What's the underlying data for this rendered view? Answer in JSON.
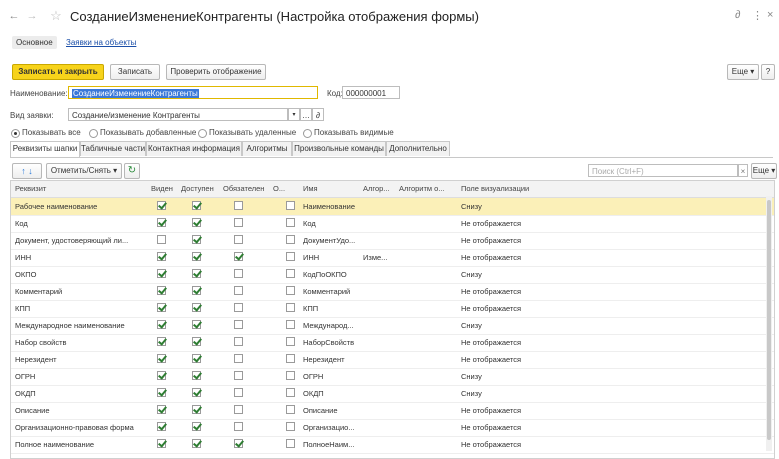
{
  "window": {
    "title": "СозданиеИзменениеКонтрагенты (Настройка отображения формы)"
  },
  "top_tabs": [
    {
      "label": "Основное"
    },
    {
      "label": "Заявки на объекты"
    }
  ],
  "toolbar": {
    "save_close": "Записать и закрыть",
    "save": "Записать",
    "check": "Проверить отображение",
    "more": "Еще",
    "help": "?"
  },
  "form": {
    "name_label": "Наименование:",
    "name_value": "СозданиеИзменениеКонтрагенты",
    "code_label": "Код:",
    "code_value": "000000001",
    "type_label": "Вид заявки:",
    "type_value": "Создание/изменение Контрагенты"
  },
  "radios": [
    {
      "label": "Показывать все",
      "checked": true
    },
    {
      "label": "Показывать добавленные",
      "checked": false
    },
    {
      "label": "Показывать удаленные",
      "checked": false
    },
    {
      "label": "Показывать видимые",
      "checked": false
    }
  ],
  "sub_tabs": [
    "Реквизиты шапки",
    "Табличные части",
    "Контактная информация",
    "Алгоритмы",
    "Произвольные команды",
    "Дополнительно"
  ],
  "table_toolbar": {
    "mark": "Отметить/Снять",
    "search_placeholder": "Поиск (Ctrl+F)",
    "more": "Еще"
  },
  "columns": [
    "Реквизит",
    "Виден",
    "Доступен",
    "Обязателен",
    "О...",
    "Имя",
    "Алгор...",
    "Алгоритм о...",
    "Поле визуализации"
  ],
  "rows": [
    {
      "rekvizit": "Рабочее наименование",
      "viden": true,
      "dostupen": true,
      "obyaz": false,
      "o": false,
      "imya": "Наименование",
      "algor": "",
      "algoritm": "",
      "pole": "Снизу",
      "selected": true
    },
    {
      "rekvizit": "Код",
      "viden": true,
      "dostupen": true,
      "obyaz": false,
      "o": false,
      "imya": "Код",
      "algor": "",
      "algoritm": "",
      "pole": "Не отображается",
      "selected": false
    },
    {
      "rekvizit": "Документ, удостоверяющий ли...",
      "viden": false,
      "dostupen": true,
      "obyaz": false,
      "o": false,
      "imya": "ДокументУдо...",
      "algor": "",
      "algoritm": "",
      "pole": "Не отображается",
      "selected": false
    },
    {
      "rekvizit": "ИНН",
      "viden": true,
      "dostupen": true,
      "obyaz": true,
      "o": false,
      "imya": "ИНН",
      "algor": "Изме...",
      "algoritm": "",
      "pole": "Не отображается",
      "selected": false
    },
    {
      "rekvizit": "ОКПО",
      "viden": true,
      "dostupen": true,
      "obyaz": false,
      "o": false,
      "imya": "КодПоОКПО",
      "algor": "",
      "algoritm": "",
      "pole": "Снизу",
      "selected": false
    },
    {
      "rekvizit": "Комментарий",
      "viden": true,
      "dostupen": true,
      "obyaz": false,
      "o": false,
      "imya": "Комментарий",
      "algor": "",
      "algoritm": "",
      "pole": "Не отображается",
      "selected": false
    },
    {
      "rekvizit": "КПП",
      "viden": true,
      "dostupen": true,
      "obyaz": false,
      "o": false,
      "imya": "КПП",
      "algor": "",
      "algoritm": "",
      "pole": "Не отображается",
      "selected": false
    },
    {
      "rekvizit": "Международное наименование",
      "viden": true,
      "dostupen": true,
      "obyaz": false,
      "o": false,
      "imya": "Международ...",
      "algor": "",
      "algoritm": "",
      "pole": "Снизу",
      "selected": false
    },
    {
      "rekvizit": "Набор свойств",
      "viden": true,
      "dostupen": true,
      "obyaz": false,
      "o": false,
      "imya": "НаборСвойств",
      "algor": "",
      "algoritm": "",
      "pole": "Не отображается",
      "selected": false
    },
    {
      "rekvizit": "Нерезидент",
      "viden": true,
      "dostupen": true,
      "obyaz": false,
      "o": false,
      "imya": "Нерезидент",
      "algor": "",
      "algoritm": "",
      "pole": "Не отображается",
      "selected": false
    },
    {
      "rekvizit": "ОГРН",
      "viden": true,
      "dostupen": true,
      "obyaz": false,
      "o": false,
      "imya": "ОГРН",
      "algor": "",
      "algoritm": "",
      "pole": "Снизу",
      "selected": false
    },
    {
      "rekvizit": "ОКДП",
      "viden": true,
      "dostupen": true,
      "obyaz": false,
      "o": false,
      "imya": "ОКДП",
      "algor": "",
      "algoritm": "",
      "pole": "Снизу",
      "selected": false
    },
    {
      "rekvizit": "Описание",
      "viden": true,
      "dostupen": true,
      "obyaz": false,
      "o": false,
      "imya": "Описание",
      "algor": "",
      "algoritm": "",
      "pole": "Не отображается",
      "selected": false
    },
    {
      "rekvizit": "Организационно-правовая форма",
      "viden": true,
      "dostupen": true,
      "obyaz": false,
      "o": false,
      "imya": "Организацио...",
      "algor": "",
      "algoritm": "",
      "pole": "Не отображается",
      "selected": false
    },
    {
      "rekvizit": "Полное наименование",
      "viden": true,
      "dostupen": true,
      "obyaz": true,
      "o": false,
      "imya": "ПолноеНаим...",
      "algor": "",
      "algoritm": "",
      "pole": "Не отображается",
      "selected": false
    }
  ]
}
